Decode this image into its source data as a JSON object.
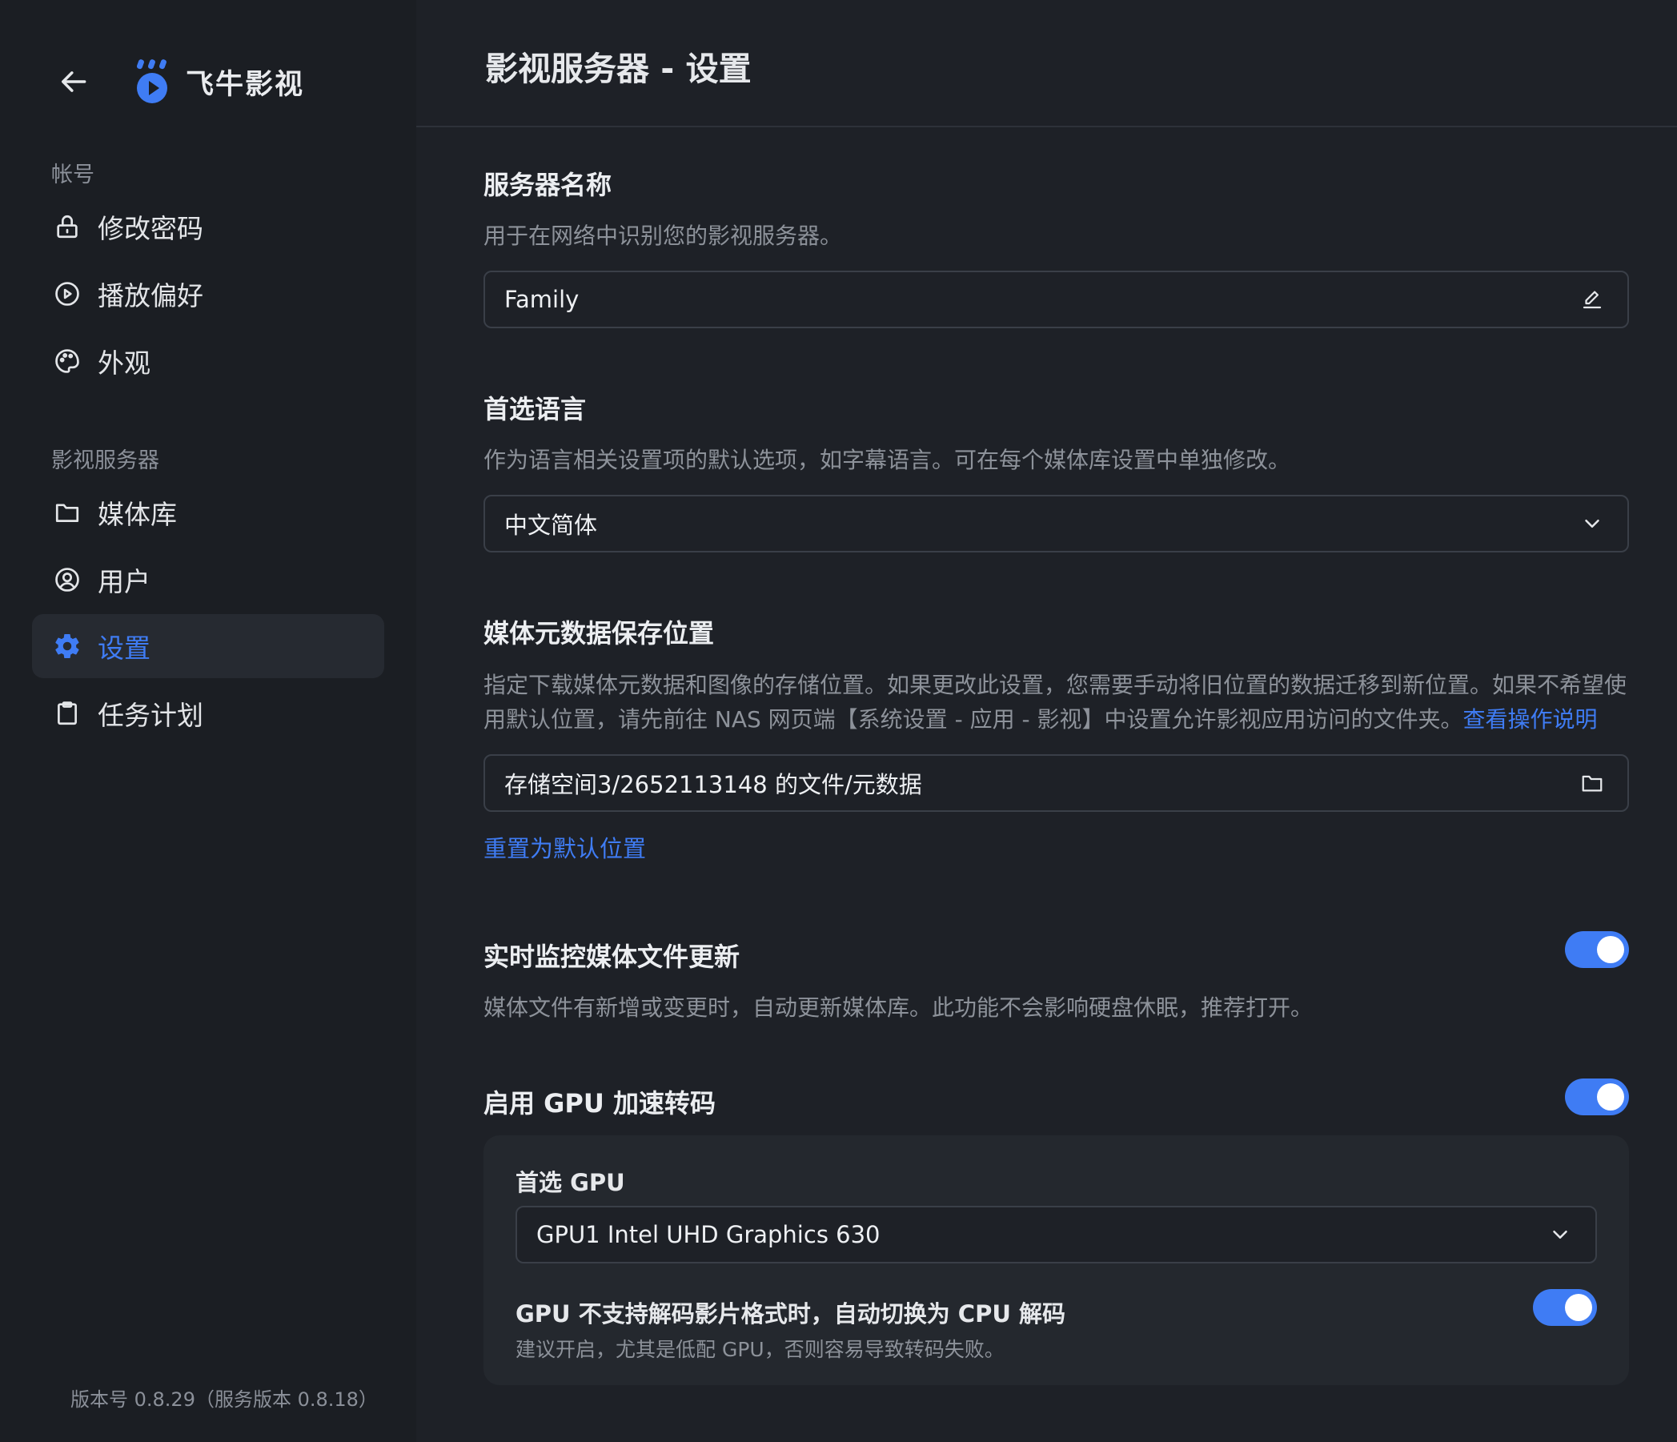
{
  "sidebar": {
    "brand_name": "飞牛影视",
    "sections": [
      {
        "label": "帐号"
      },
      {
        "label": "影视服务器"
      }
    ],
    "items": [
      {
        "label": "修改密码",
        "icon": "lock-icon"
      },
      {
        "label": "播放偏好",
        "icon": "play-circle-icon"
      },
      {
        "label": "外观",
        "icon": "palette-icon"
      },
      {
        "label": "媒体库",
        "icon": "folder-icon"
      },
      {
        "label": "用户",
        "icon": "user-circle-icon"
      },
      {
        "label": "设置",
        "icon": "gear-icon",
        "active": true
      },
      {
        "label": "任务计划",
        "icon": "clipboard-icon"
      }
    ],
    "version": "版本号 0.8.29（服务版本 0.8.18）"
  },
  "header": {
    "title": "影视服务器 - 设置"
  },
  "settings": {
    "server_name": {
      "title": "服务器名称",
      "desc": "用于在网络中识别您的影视服务器。",
      "value": "Family"
    },
    "language": {
      "title": "首选语言",
      "desc": "作为语言相关设置项的默认选项，如字幕语言。可在每个媒体库设置中单独修改。",
      "value": "中文简体"
    },
    "metadata": {
      "title": "媒体元数据保存位置",
      "desc_line1": "指定下载媒体元数据和图像的存储位置。如果更改此设置，您需要手动将旧位置的数据迁移到新位置。如果不希望使",
      "desc_line2": "用默认位置，请先前往 NAS 网页端【系统设置 - 应用 - 影视】中设置允许影视应用访问的文件夹。",
      "help_link": "查看操作说明",
      "value": "存储空间3/2652113148 的文件/元数据",
      "reset_link": "重置为默认位置"
    },
    "monitor": {
      "title": "实时监控媒体文件更新",
      "desc": "媒体文件有新增或变更时，自动更新媒体库。此功能不会影响硬盘休眠，推荐打开。",
      "enabled": true
    },
    "gpu": {
      "title": "启用 GPU 加速转码",
      "enabled": true,
      "preferred_label": "首选 GPU",
      "preferred_value": "GPU1 Intel UHD Graphics 630",
      "fallback_title": "GPU 不支持解码影片格式时，自动切换为 CPU 解码",
      "fallback_desc": "建议开启，尤其是低配 GPU，否则容易导致转码失败。",
      "fallback_enabled": true
    }
  },
  "colors": {
    "accent": "#3f7cf4",
    "background": "#1e2127",
    "sidebar": "#1b1e23"
  }
}
